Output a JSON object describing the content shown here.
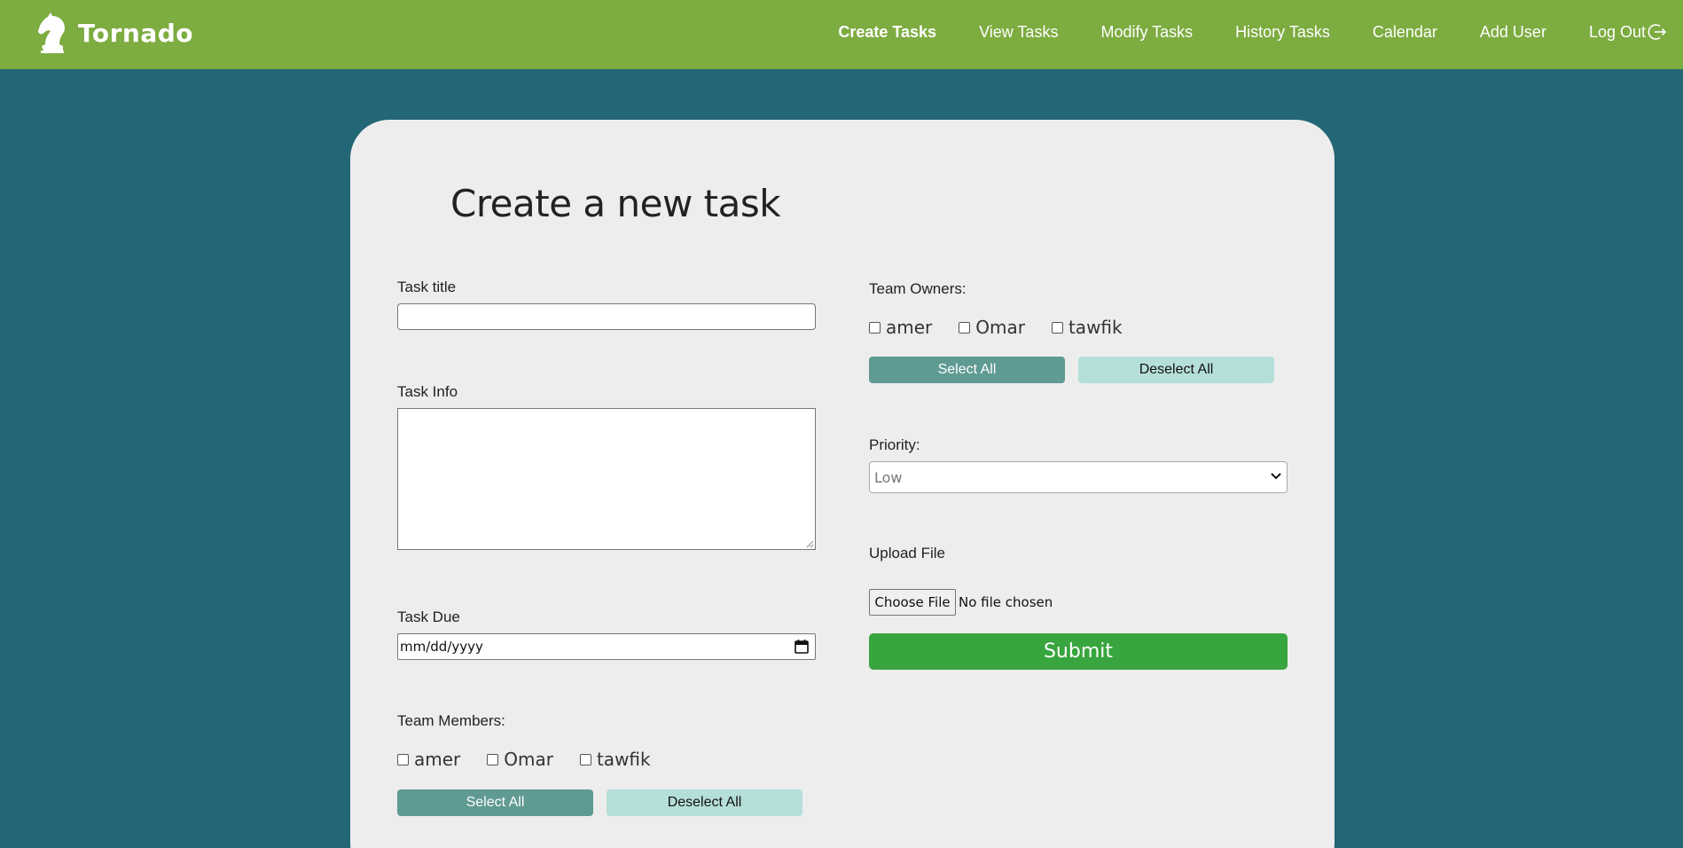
{
  "brand": {
    "name": "Tornado",
    "logo_icon": "chess-knight-icon"
  },
  "nav": {
    "items": [
      {
        "label": "Create Tasks",
        "active": true
      },
      {
        "label": "View Tasks"
      },
      {
        "label": "Modify Tasks"
      },
      {
        "label": "History Tasks"
      },
      {
        "label": "Calendar"
      },
      {
        "label": "Add User"
      },
      {
        "label": "Log Out",
        "icon": "logout-icon"
      }
    ]
  },
  "form": {
    "title": "Create a new task",
    "task_title": {
      "label": "Task title",
      "value": ""
    },
    "task_info": {
      "label": "Task Info",
      "value": ""
    },
    "task_due": {
      "label": "Task Due",
      "placeholder": "mm/dd/yyyy"
    },
    "team_members": {
      "label": "Team Members:",
      "options": [
        "amer",
        "Omar",
        "tawfik"
      ],
      "select_all": "Select All",
      "deselect_all": "Deselect All"
    },
    "team_owners": {
      "label": "Team Owners:",
      "options": [
        "amer",
        "Omar",
        "tawfik"
      ],
      "select_all": "Select All",
      "deselect_all": "Deselect All"
    },
    "priority": {
      "label": "Priority:",
      "selected": "Low"
    },
    "upload": {
      "label": "Upload File",
      "button": "Choose File",
      "status": "No file chosen"
    },
    "submit": "Submit"
  },
  "colors": {
    "navbar": "#7dac40",
    "background": "#236676",
    "card": "#ededed",
    "select_all": "#5f9a93",
    "deselect_all": "#b5dfd9",
    "submit": "#38a53e"
  }
}
